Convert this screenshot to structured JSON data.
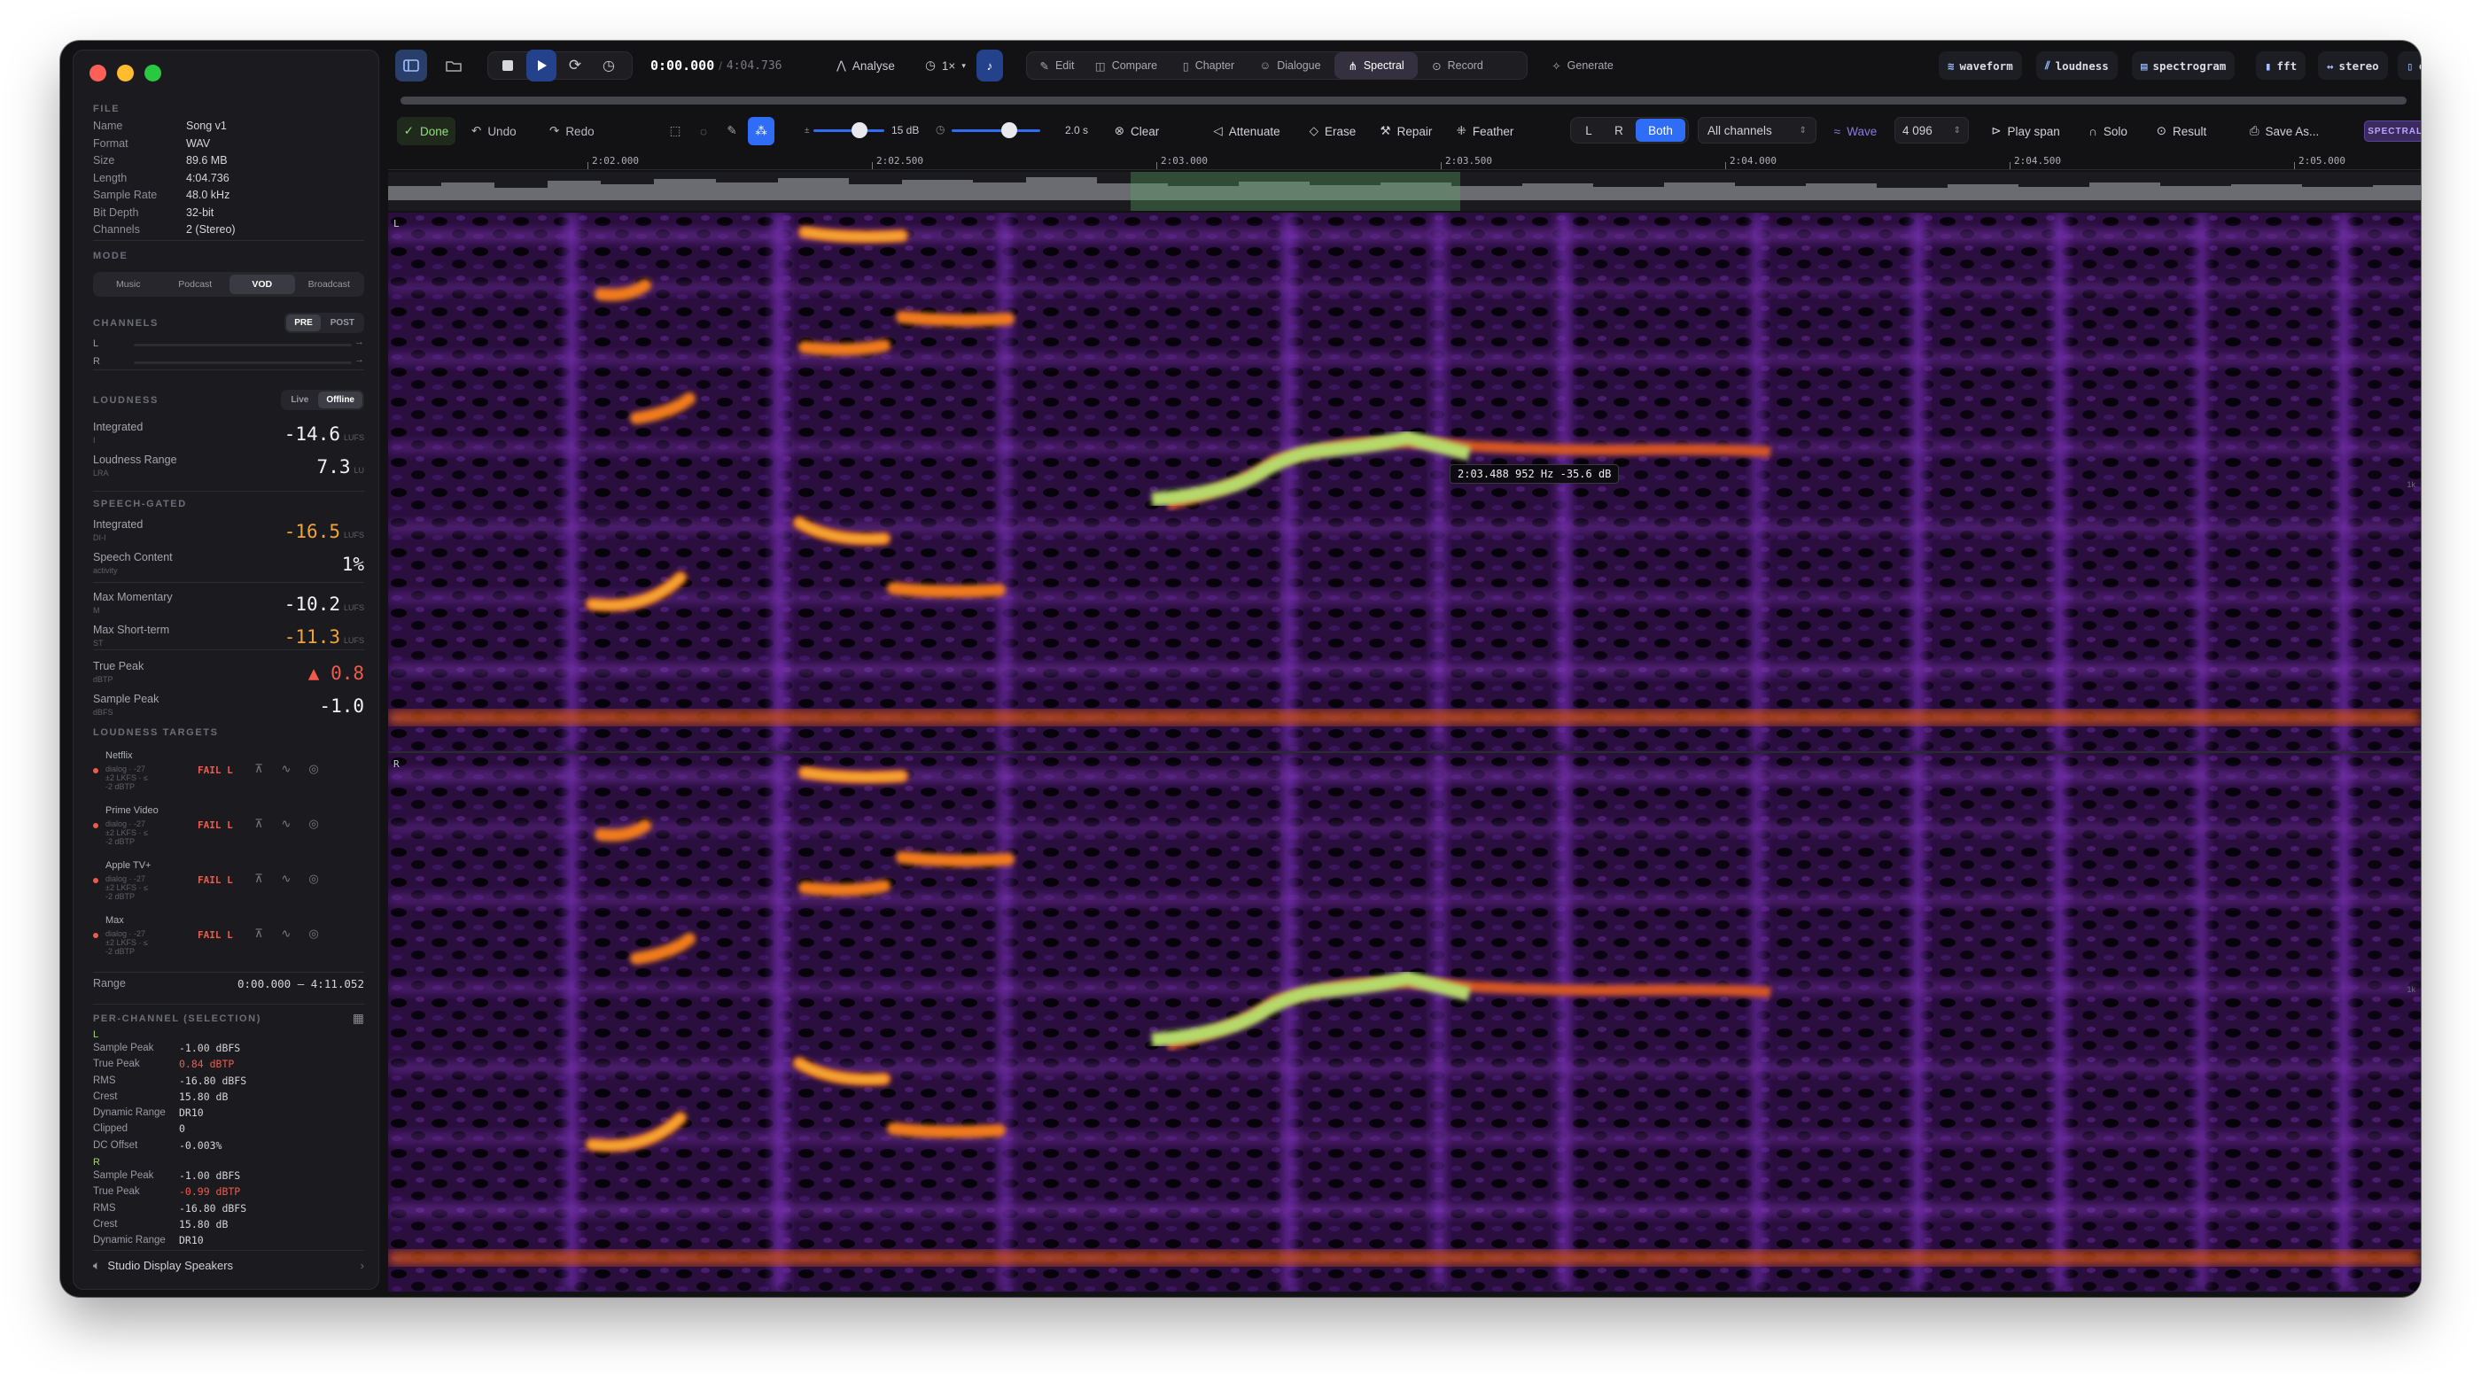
{
  "file": {
    "section_title": "FILE",
    "rows": [
      {
        "k": "Name",
        "v": "Song v1"
      },
      {
        "k": "Format",
        "v": "WAV"
      },
      {
        "k": "Size",
        "v": "89.6 MB"
      },
      {
        "k": "Length",
        "v": "4:04.736"
      },
      {
        "k": "Sample Rate",
        "v": "48.0 kHz"
      },
      {
        "k": "Bit Depth",
        "v": "32-bit"
      },
      {
        "k": "Channels",
        "v": "2 (Stereo)"
      }
    ]
  },
  "mode": {
    "title": "MODE",
    "options": [
      "Music",
      "Podcast",
      "VOD",
      "Broadcast"
    ],
    "selected": "VOD"
  },
  "channels": {
    "title": "CHANNELS",
    "pre": "PRE",
    "post": "POST",
    "l": "L",
    "r": "R",
    "l_arrow": "→",
    "r_arrow": "→"
  },
  "loudness": {
    "title": "LOUDNESS",
    "live": "Live",
    "offline": "Offline",
    "integrated": {
      "label": "Integrated",
      "sub": "I",
      "value": "-14.6",
      "unit": "LUFS"
    },
    "range": {
      "label": "Loudness Range",
      "sub": "LRA",
      "value": "7.3",
      "unit": "LU"
    }
  },
  "speech": {
    "title": "SPEECH-GATED",
    "integrated": {
      "label": "Integrated",
      "sub": "DI-I",
      "value": "-16.5",
      "unit": "LUFS"
    },
    "content": {
      "label": "Speech Content",
      "sub": "activity",
      "value": "1%"
    },
    "max_momentary": {
      "label": "Max Momentary",
      "sub": "M",
      "value": "-10.2",
      "unit": "LUFS"
    },
    "max_short": {
      "label": "Max Short-term",
      "sub": "ST",
      "value": "-11.3",
      "unit": "LUFS"
    },
    "true_peak": {
      "label": "True Peak",
      "sub": "dBTP",
      "value": "▲ 0.8"
    },
    "sample_peak": {
      "label": "Sample Peak",
      "sub": "dBFS",
      "value": "-1.0"
    }
  },
  "targets": {
    "title": "LOUDNESS TARGETS",
    "items": [
      {
        "name": "Netflix",
        "desc1": "dialog · -27",
        "desc2": "±2 LKFS · ≤",
        "desc3": "-2 dBTP",
        "status": "FAIL L"
      },
      {
        "name": "Prime Video",
        "desc1": "dialog · -27",
        "desc2": "±2 LKFS · ≤",
        "desc3": "-2 dBTP",
        "status": "FAIL L"
      },
      {
        "name": "Apple TV+",
        "desc1": "dialog · -27",
        "desc2": "±2 LKFS · ≤",
        "desc3": "-2 dBTP",
        "status": "FAIL L"
      },
      {
        "name": "Max",
        "desc1": "dialog · -27",
        "desc2": "±2 LKFS · ≤",
        "desc3": "-2 dBTP",
        "status": "FAIL L"
      }
    ]
  },
  "range_row": {
    "label": "Range",
    "value": "0:00.000 – 4:11.052"
  },
  "per_channel": {
    "title": "PER-CHANNEL (SELECTION)",
    "L": {
      "label": "L",
      "rows": [
        {
          "k": "Sample Peak",
          "v": "-1.00 dBFS"
        },
        {
          "k": "True Peak",
          "v": "0.84 dBTP",
          "warn": true
        },
        {
          "k": "RMS",
          "v": "-16.80 dBFS"
        },
        {
          "k": "Crest",
          "v": "15.80 dB"
        },
        {
          "k": "Dynamic Range",
          "v": "DR10"
        },
        {
          "k": "Clipped",
          "v": "0"
        },
        {
          "k": "DC Offset",
          "v": "-0.003%"
        }
      ]
    },
    "R": {
      "label": "R",
      "rows": [
        {
          "k": "Sample Peak",
          "v": "-1.00 dBFS"
        },
        {
          "k": "True Peak",
          "v": "-0.99 dBTP",
          "warn": true
        },
        {
          "k": "RMS",
          "v": "-16.80 dBFS"
        },
        {
          "k": "Crest",
          "v": "15.80 dB"
        },
        {
          "k": "Dynamic Range",
          "v": "DR10"
        }
      ]
    }
  },
  "output": {
    "label": "Studio Display Speakers",
    "chevron": "›"
  },
  "transport": {
    "time": "0:00.000",
    "sep": "/",
    "total": "4:04.736",
    "analyse": "Analyse",
    "rate": "1×"
  },
  "mode_tabs": [
    "Edit",
    "Compare",
    "Chapter",
    "Dialogue",
    "Spectral",
    "Record"
  ],
  "active_tab": "Spectral",
  "generate": "Generate",
  "view_tags": [
    "waveform",
    "loudness",
    "spectrogram",
    "fft",
    "stereo",
    "chapters"
  ],
  "spectral_bar": {
    "done": "Done",
    "undo": "Undo",
    "redo": "Redo",
    "db_label": "15 dB",
    "s_label": "2.0 s",
    "clear": "Clear",
    "attenuate": "Attenuate",
    "erase": "Erase",
    "repair": "Repair",
    "feather": "Feather",
    "ch_l": "L",
    "ch_r": "R",
    "ch_both": "Both",
    "channels_select": "All channels",
    "wave": "Wave",
    "fft_size": "4 096",
    "play_span": "Play span",
    "solo": "Solo",
    "result": "Result",
    "save_as": "Save As...",
    "mode_badge": "SPECTRAL MODE"
  },
  "ruler": [
    "2:02.000",
    "2:02.500",
    "2:03.000",
    "2:03.500",
    "2:04.000",
    "2:04.500",
    "2:05.000"
  ],
  "spectrogram": {
    "left_label": "L",
    "right_label": "R",
    "tooltip": "2:03.488  952 Hz  -35.6 dB",
    "axis_tag": "1k"
  },
  "colors": {
    "accent": "#2f6df6",
    "fail": "#ef5a4d",
    "warn": "#f0a33a",
    "selection": "#a7d36b"
  }
}
